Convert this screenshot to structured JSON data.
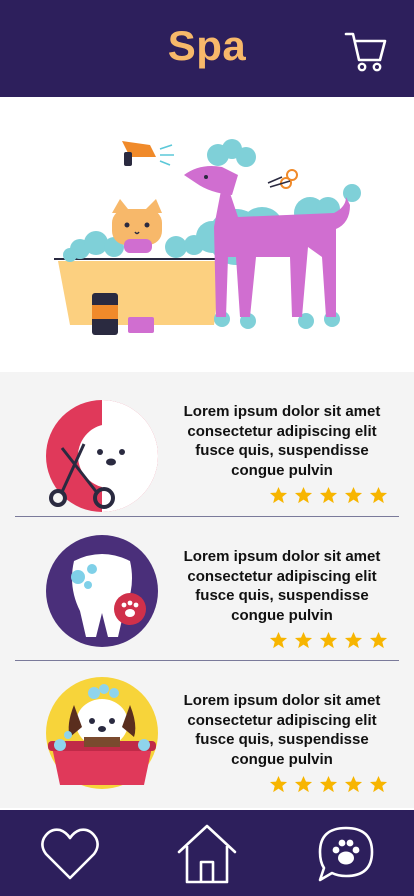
{
  "header": {
    "title": "Spa",
    "cart_icon": "cart-icon"
  },
  "hero": {
    "illustration": "cat-and-poodle-spa-illustration"
  },
  "services": [
    {
      "icon": "dog-grooming-scissors-icon",
      "description": "Lorem ipsum dolor sit amet consectetur adipiscing elit fusce quis, suspendisse congue pulvin",
      "rating": 5
    },
    {
      "icon": "tooth-paw-icon",
      "description": "Lorem ipsum dolor sit amet consectetur adipiscing elit fusce quis, suspendisse congue pulvin",
      "rating": 5
    },
    {
      "icon": "dog-bath-icon",
      "description": "Lorem ipsum dolor sit amet consectetur adipiscing elit fusce quis, suspendisse congue pulvin",
      "rating": 5
    }
  ],
  "footer": {
    "items": [
      "heart-icon",
      "home-icon",
      "paw-chat-icon"
    ]
  },
  "colors": {
    "primary": "#2d1f5c",
    "accent": "#f7b86a",
    "star": "#f7b500",
    "section_bg": "#f4f4f4"
  }
}
